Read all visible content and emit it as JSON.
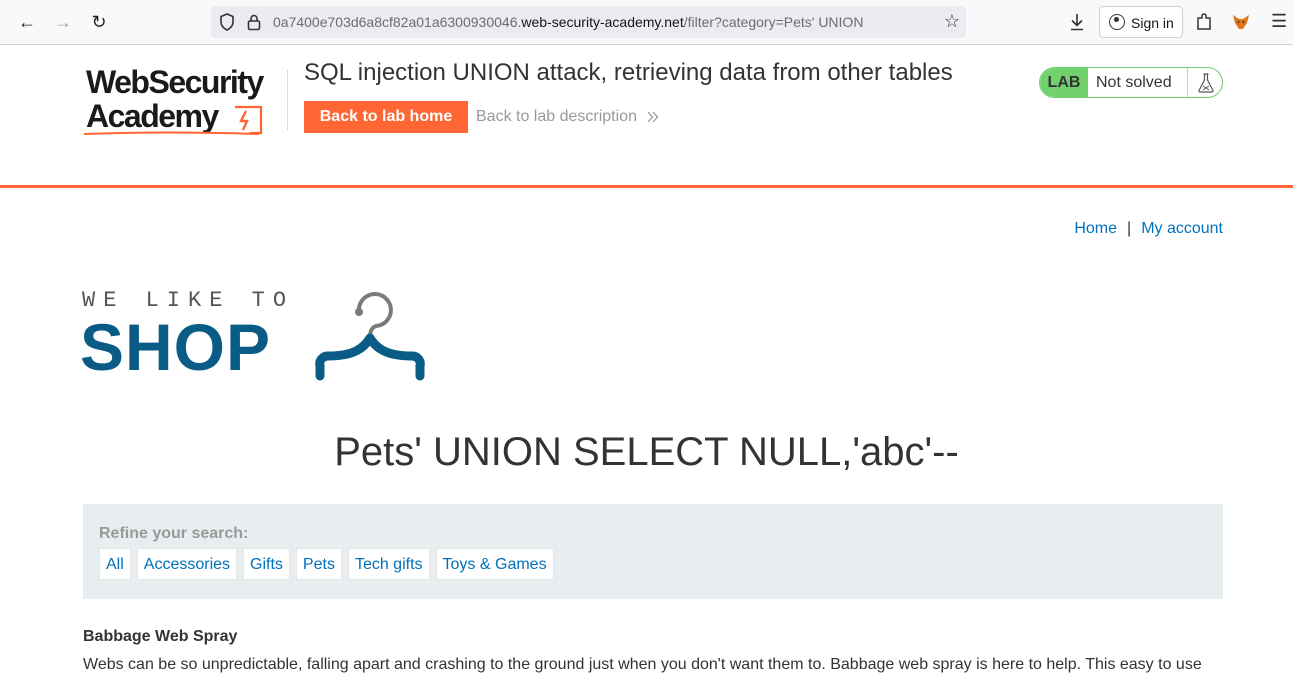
{
  "browser": {
    "url_prefix": "0a7400e703d6a8cf82a01a6300930046.",
    "url_host": "web-security-academy.net",
    "url_path": "/filter?category=Pets' UNION",
    "signin_label": "Sign in"
  },
  "academy": {
    "logo_line1": "WebSecurity",
    "logo_line2": "Academy",
    "lab_title": "SQL injection UNION attack, retrieving data from other tables",
    "back_home_label": "Back to lab home",
    "back_desc_label": "Back to lab description",
    "lab_badge": "LAB",
    "lab_status": "Not solved",
    "colors": {
      "accent": "#ff6633",
      "solved_green": "#70d16d",
      "link": "#0071bc",
      "shop_blue": "#0a5c86"
    }
  },
  "nav": {
    "home": "Home",
    "separator": "|",
    "my_account": "My account"
  },
  "shop_logo": {
    "tagline": "WE LIKE TO",
    "word": "SHOP"
  },
  "page": {
    "heading": "Pets' UNION SELECT NULL,'abc'--",
    "refine_label": "Refine your search:",
    "filters": [
      "All",
      "Accessories",
      "Gifts",
      "Pets",
      "Tech gifts",
      "Toys & Games"
    ]
  },
  "products": [
    {
      "name": "Babbage Web Spray",
      "description": "Webs can be so unpredictable, falling apart and crashing to the ground just when you don't want them to. Babbage web spray is here to help. This easy to use"
    }
  ]
}
